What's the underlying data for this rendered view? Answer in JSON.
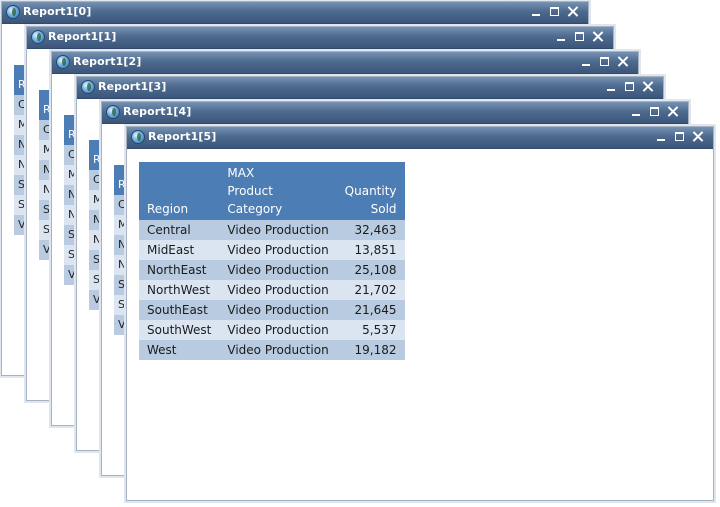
{
  "windows": [
    {
      "title": "Report1[0]",
      "peek_header": "R",
      "peek_rows": [
        "C",
        "M",
        "N",
        "N",
        "S",
        "S",
        "V"
      ]
    },
    {
      "title": "Report1[1]",
      "peek_header": "R",
      "peek_rows": [
        "C",
        "M",
        "N",
        "N",
        "S",
        "S",
        "V"
      ]
    },
    {
      "title": "Report1[2]",
      "peek_header": "R",
      "peek_rows": [
        "C",
        "M",
        "N",
        "N",
        "S",
        "S",
        "V"
      ]
    },
    {
      "title": "Report1[3]",
      "peek_header": "R",
      "peek_rows": [
        "C",
        "M",
        "N",
        "N",
        "S",
        "S",
        "V"
      ]
    },
    {
      "title": "Report1[4]",
      "peek_header": "R",
      "peek_rows": [
        "C",
        "M",
        "N",
        "N",
        "S",
        "S",
        "V"
      ]
    },
    {
      "title": "Report1[5]"
    }
  ],
  "report": {
    "headers": {
      "region": "Region",
      "category_line1": "MAX",
      "category_line2": "Product",
      "category_line3": "Category",
      "quantity_line1": "Quantity",
      "quantity_line2": "Sold"
    },
    "rows": [
      {
        "region": "Central",
        "category": "Video Production",
        "quantity": "32,463"
      },
      {
        "region": "MidEast",
        "category": "Video Production",
        "quantity": "13,851"
      },
      {
        "region": "NorthEast",
        "category": "Video Production",
        "quantity": "25,108"
      },
      {
        "region": "NorthWest",
        "category": "Video Production",
        "quantity": "21,702"
      },
      {
        "region": "SouthEast",
        "category": "Video Production",
        "quantity": "21,645"
      },
      {
        "region": "SouthWest",
        "category": "Video Production",
        "quantity": "5,537"
      },
      {
        "region": "West",
        "category": "Video Production",
        "quantity": "19,182"
      }
    ]
  },
  "colors": {
    "titlebar": "#4d6a8f",
    "table_header": "#4d7db5",
    "row_dark": "#b9cbe0",
    "row_light": "#dbe5f2"
  },
  "icons": {
    "app": "report-app-icon",
    "minimize": "minimize-icon",
    "maximize": "maximize-icon",
    "close": "close-icon"
  }
}
